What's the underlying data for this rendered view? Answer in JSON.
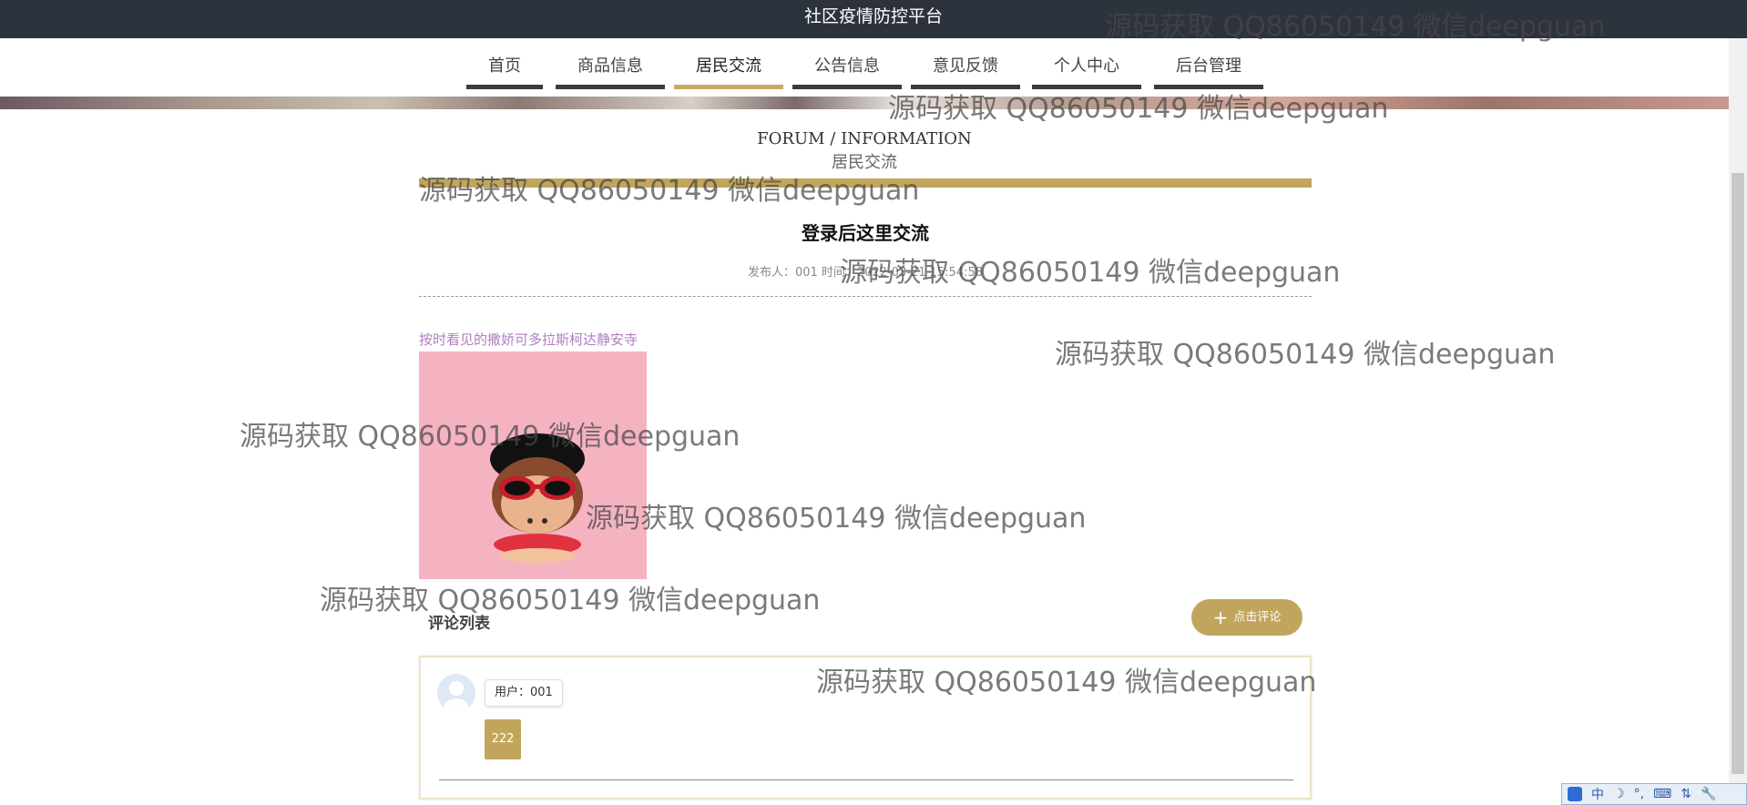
{
  "header": {
    "title": "社区疫情防控平台"
  },
  "nav": {
    "items": [
      {
        "label": "首页"
      },
      {
        "label": "商品信息"
      },
      {
        "label": "居民交流"
      },
      {
        "label": "公告信息"
      },
      {
        "label": "意见反馈"
      },
      {
        "label": "个人中心"
      },
      {
        "label": "后台管理"
      }
    ],
    "active_index": 2
  },
  "section": {
    "title_en": "FORUM / INFORMATION",
    "title_cn": "居民交流"
  },
  "post": {
    "title": "登录后这里交流",
    "meta": "发布人：001 时间：2022-03-21 15:54:58",
    "body": "按时看见的撒娇可多拉斯柯达静安寺"
  },
  "comments": {
    "heading": "评论列表",
    "add_button": "点击评论",
    "items": [
      {
        "user": "用户：001",
        "content": "222"
      }
    ]
  },
  "watermark_text": "源码获取 QQ86050149 微信deepguan",
  "ime": {
    "labels": [
      "中",
      "☽",
      "°,",
      "⌨",
      "⇅",
      "🔧"
    ]
  },
  "colors": {
    "accent": "#c2a55c",
    "topbar": "#2d333c",
    "post_body": "#b07ec0",
    "image_bg": "#f5b3c2"
  }
}
